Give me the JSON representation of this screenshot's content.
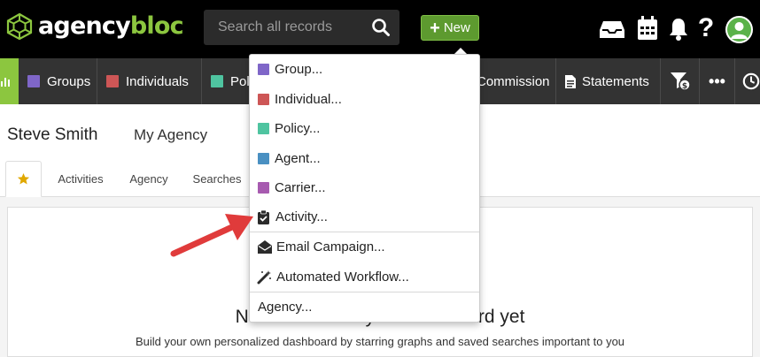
{
  "brand": {
    "name_part1": "agency",
    "name_part2": "bloc"
  },
  "search": {
    "placeholder": "Search all records"
  },
  "new_button": {
    "label": "New"
  },
  "nav": {
    "items": [
      {
        "label": "Groups",
        "color": "#7f66c8"
      },
      {
        "label": "Individuals",
        "color": "#cd5656"
      },
      {
        "label": "Pol",
        "color": "#4fc4a0"
      },
      {
        "label": "Commission"
      },
      {
        "label": "Statements"
      }
    ]
  },
  "profile": {
    "user_name": "Steve Smith",
    "agency_name": "My Agency"
  },
  "tabs": [
    {
      "label": "Activities"
    },
    {
      "label": "Agency"
    },
    {
      "label": "Searches"
    }
  ],
  "dashboard": {
    "empty_title": "No favorites on your dashboard yet",
    "empty_subtitle": "Build your own personalized dashboard by starring graphs and saved searches important to you"
  },
  "new_menu": {
    "items": [
      {
        "label": "Group...",
        "color": "#7f66c8"
      },
      {
        "label": "Individual...",
        "color": "#cd5656"
      },
      {
        "label": "Policy...",
        "color": "#4fc4a0"
      },
      {
        "label": "Agent...",
        "color": "#4a90c2"
      },
      {
        "label": "Carrier...",
        "color": "#a75bb0"
      },
      {
        "label": "Activity...",
        "icon": "clipboard-check-icon"
      },
      {
        "label": "Email Campaign...",
        "icon": "envelope-open-icon"
      },
      {
        "label": "Automated Workflow...",
        "icon": "magic-wand-icon"
      },
      {
        "label": "Agency..."
      }
    ]
  },
  "colors": {
    "brand_green": "#8cc63f",
    "new_button": "#5d9a2f",
    "arrow_red": "#e03b3b"
  }
}
